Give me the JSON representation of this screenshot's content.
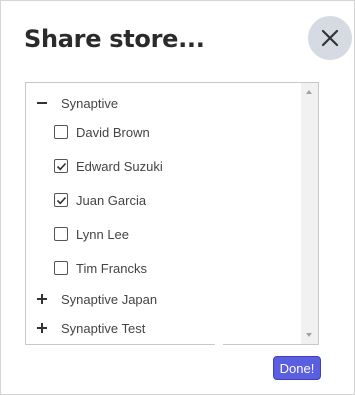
{
  "dialog": {
    "title": "Share store...",
    "close_icon": "close-icon",
    "done_label": "Done!"
  },
  "tree": {
    "groups": [
      {
        "label": "Synaptive",
        "state": "expanded",
        "members": [
          {
            "name": "David Brown",
            "checked": false
          },
          {
            "name": "Edward Suzuki",
            "checked": true
          },
          {
            "name": "Juan Garcia",
            "checked": true
          },
          {
            "name": "Lynn Lee",
            "checked": false
          },
          {
            "name": "Tim Francks",
            "checked": false
          }
        ]
      },
      {
        "label": "Synaptive Japan",
        "state": "collapsed"
      },
      {
        "label": "Synaptive Test",
        "state": "collapsed"
      }
    ]
  },
  "colors": {
    "done_button": "#5a5ee0",
    "close_button_bg": "#d6dbe3"
  }
}
